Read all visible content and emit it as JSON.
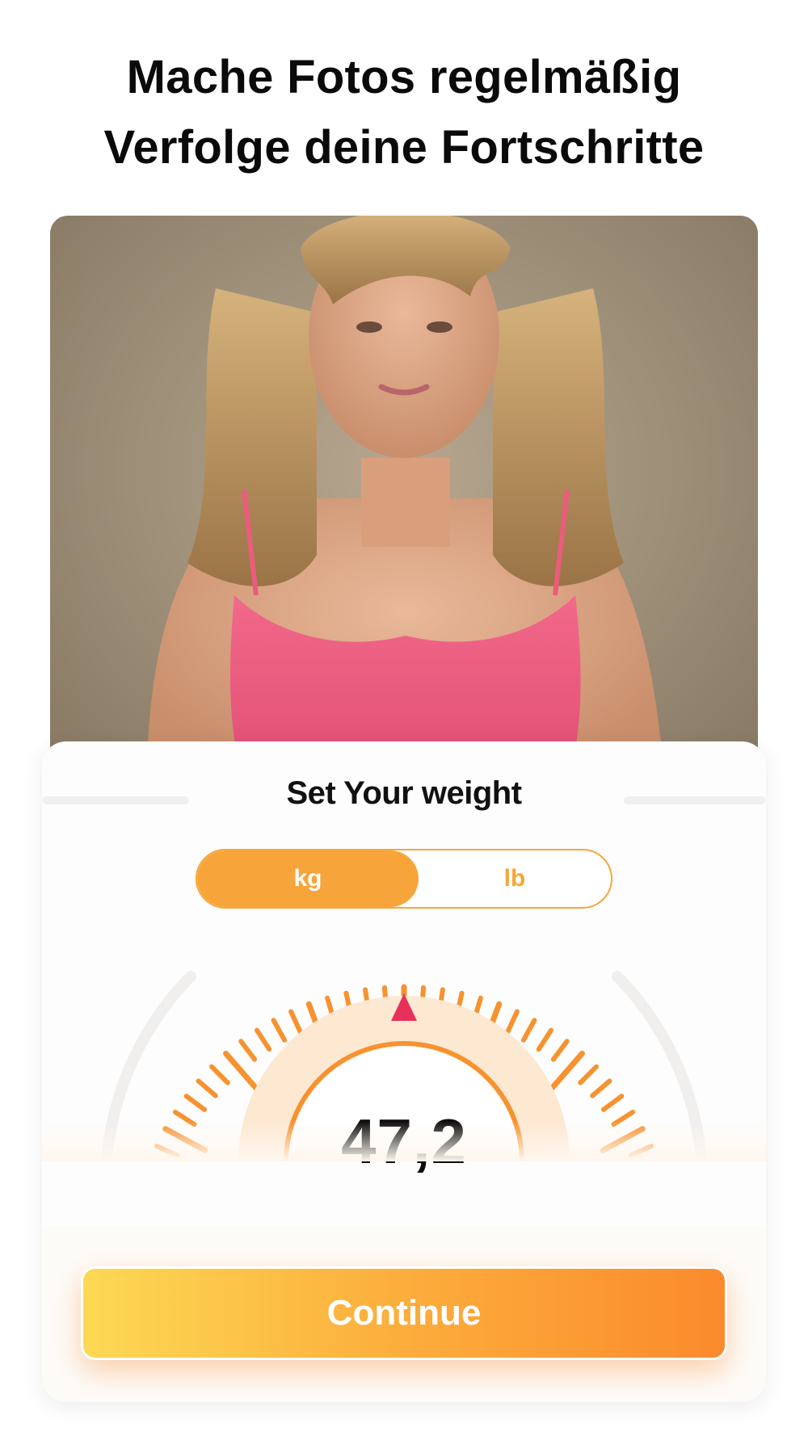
{
  "headline": {
    "line1": "Mache Fotos regelmäßig",
    "line2": "Verfolge deine Fortschritte"
  },
  "weight_card": {
    "title": "Set Your weight",
    "units": [
      {
        "label": "kg",
        "selected": true
      },
      {
        "label": "lb",
        "selected": false
      }
    ],
    "value": "47,2",
    "continue_label": "Continue"
  },
  "colors": {
    "accent": "#f7a53a",
    "indicator": "#e8315a",
    "button_gradient": [
      "#fcd954",
      "#fb8a2c"
    ]
  }
}
